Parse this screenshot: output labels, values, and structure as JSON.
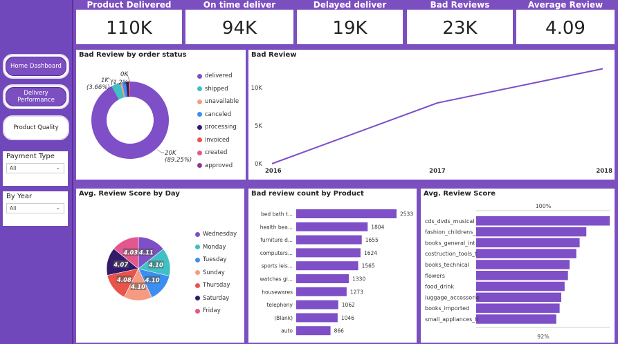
{
  "kpis": [
    {
      "title": "Product Delivered",
      "value": "110K"
    },
    {
      "title": "On time deliver",
      "value": "94K"
    },
    {
      "title": "Delayed deliver",
      "value": "19K"
    },
    {
      "title": "Bad Reviews",
      "value": "23K"
    },
    {
      "title": "Average Review Score",
      "value": "4.09"
    }
  ],
  "nav": {
    "home": "Home Dashboard",
    "delivery": "Delivery Performance",
    "product": "Product Quality"
  },
  "slicers": {
    "payment": {
      "label": "Payment Type",
      "value": "All"
    },
    "year": {
      "label": "By Year",
      "value": "All"
    }
  },
  "panels": {
    "status_title": "Bad Review by order status",
    "trend_title": "Bad Review",
    "day_title": "Avg. Review Score by Day",
    "product_title": "Bad review count by Product",
    "score_title": "Avg. Review Score"
  },
  "colors": {
    "accent": "#7b4fc0",
    "bar": "#7e4fc7"
  },
  "chart_data": [
    {
      "type": "pie",
      "title": "Bad Review by order status",
      "labels": [
        "delivered",
        "shipped",
        "unavailable",
        "canceled",
        "processing",
        "invoiced",
        "created",
        "approved"
      ],
      "values": [
        20500,
        840,
        180,
        350,
        260,
        120,
        8,
        4
      ],
      "colors": [
        "#7e4fc7",
        "#3fc0c4",
        "#f69b82",
        "#3b8ff0",
        "#331a6b",
        "#e8534a",
        "#e3578e",
        "#8e3a8f"
      ],
      "annotations": [
        {
          "text": "20K",
          "sub": "(89.25%)",
          "target": 0
        },
        {
          "text": "1K",
          "sub": "(3.66%)",
          "target": 1
        },
        {
          "text": "0K",
          "sub": "(1.2%)",
          "target": 5
        }
      ]
    },
    {
      "type": "line",
      "title": "Bad Review",
      "x": [
        "2016",
        "2017",
        "2018"
      ],
      "values": [
        0,
        8000,
        12500
      ],
      "yticks": [
        0,
        5000,
        10000
      ],
      "ytick_labels": [
        "0K",
        "5K",
        "10K"
      ],
      "ylim": [
        0,
        13000
      ]
    },
    {
      "type": "pie",
      "title": "Avg. Review Score by Day",
      "labels": [
        "Wednesday",
        "Monday",
        "Tuesday",
        "Sunday",
        "Thursday",
        "Saturday",
        "Friday"
      ],
      "values": [
        4.11,
        4.1,
        4.1,
        4.1,
        4.08,
        4.07,
        4.03
      ],
      "colors": [
        "#7e4fc7",
        "#3fc0c4",
        "#3b8ff0",
        "#f69b82",
        "#e8534a",
        "#331a6b",
        "#e3578e"
      ],
      "slice_labels": [
        "4.11",
        "4.10",
        "4.10",
        "4.10",
        "4.08",
        "4.07",
        "4.03"
      ]
    },
    {
      "type": "bar",
      "title": "Bad review count by Product",
      "categories": [
        "bed bath t...",
        "health bea...",
        "furniture d...",
        "computers...",
        "sports leis...",
        "watches gi...",
        "housewares",
        "telephony",
        "(Blank)",
        "auto"
      ],
      "values": [
        2533,
        1804,
        1655,
        1624,
        1565,
        1330,
        1273,
        1062,
        1046,
        866
      ],
      "xlim": [
        0,
        2533
      ]
    },
    {
      "type": "bar",
      "title": "Avg. Review Score",
      "categories": [
        "cds_dvds_musical",
        "fashion_childrens_",
        "books_general_int",
        "costruction_tools_t",
        "books_technical",
        "flowers",
        "food_drink",
        "luggage_accessorie",
        "books_imported",
        "small_appliances_h"
      ],
      "values": [
        100,
        98.6,
        98.2,
        98.0,
        97.6,
        97.5,
        97.3,
        97.1,
        97.0,
        96.8
      ],
      "top_label": "100%",
      "bottom_label": "92%",
      "xlim": [
        92,
        100
      ]
    }
  ]
}
